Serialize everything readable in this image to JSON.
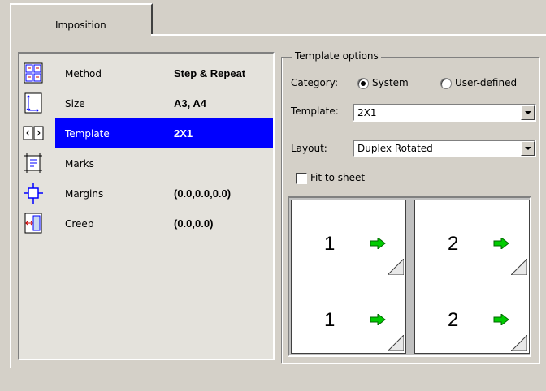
{
  "tab": {
    "label": "Imposition"
  },
  "properties": [
    {
      "name": "Method",
      "value": "Step & Repeat",
      "icon": "method-icon"
    },
    {
      "name": "Size",
      "value": "A3, A4",
      "icon": "size-icon"
    },
    {
      "name": "Template",
      "value": "2X1",
      "icon": "template-icon",
      "selected": true
    },
    {
      "name": "Marks",
      "value": "",
      "icon": "marks-icon"
    },
    {
      "name": "Margins",
      "value": "(0.0,0.0,0.0)",
      "icon": "margins-icon"
    },
    {
      "name": "Creep",
      "value": "(0.0,0.0)",
      "icon": "creep-icon"
    }
  ],
  "template_options": {
    "title": "Template options",
    "category_label": "Category:",
    "category_options": [
      "System",
      "User-defined"
    ],
    "category_selected": "System",
    "template_label": "Template:",
    "template_value": "2X1",
    "layout_label": "Layout:",
    "layout_value": "Duplex Rotated",
    "fit_label": "Fit to sheet",
    "fit_checked": false
  },
  "preview": {
    "sheets": [
      {
        "pages": [
          "1",
          "1"
        ]
      },
      {
        "pages": [
          "2",
          "2"
        ]
      }
    ]
  },
  "colors": {
    "selection": "#0000ff",
    "arrow": "#00cc00"
  }
}
